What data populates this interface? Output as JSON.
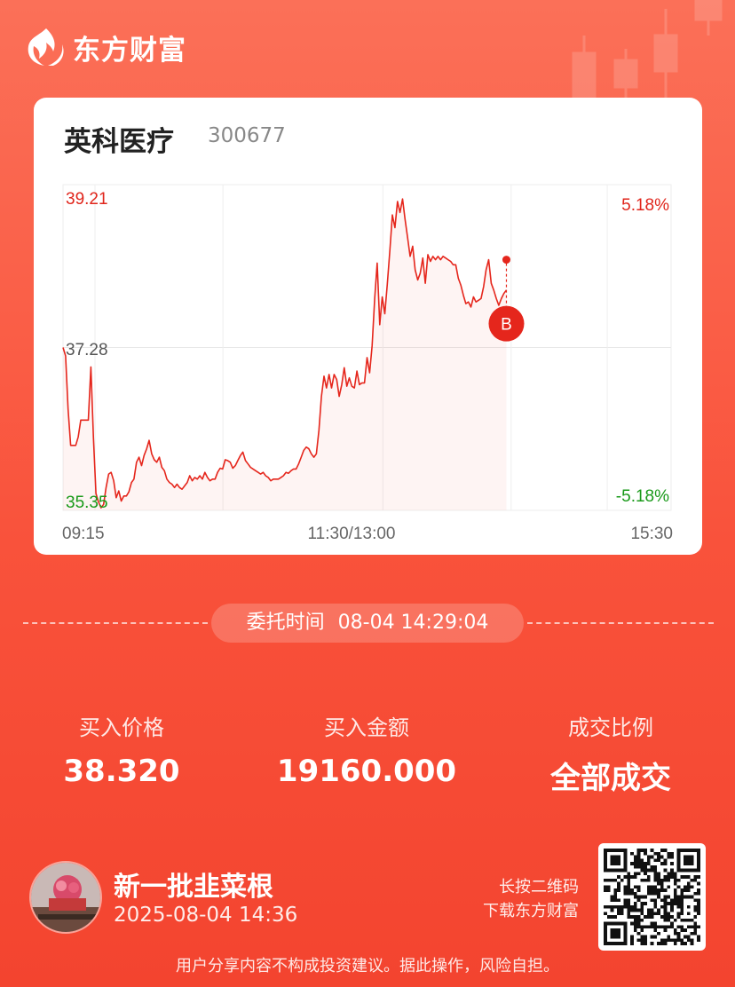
{
  "app": {
    "brand": "东方财富"
  },
  "stock": {
    "name": "英科医疗",
    "code": "300677"
  },
  "chart_data": {
    "type": "line",
    "title": "",
    "y_left_ticks": [
      "39.21",
      "37.28",
      "35.35"
    ],
    "y_right_ticks": [
      "5.18%",
      "-5.18%"
    ],
    "x_ticks": [
      "09:15",
      "11:30/13:00",
      "15:30"
    ],
    "ylim": [
      35.35,
      39.21
    ],
    "prev_close": 37.28,
    "series": [
      {
        "values": [
          37.28,
          37.18,
          36.55,
          36.12,
          36.12,
          36.12,
          36.22,
          36.42,
          36.42,
          36.42,
          36.42,
          37.05,
          36.2,
          35.55,
          35.45,
          35.38,
          35.42,
          35.62,
          35.78,
          35.8,
          35.7,
          35.5,
          35.58,
          35.46,
          35.52,
          35.52,
          35.57,
          35.68,
          35.72,
          35.92,
          35.98,
          35.88,
          36.0,
          36.08,
          36.18,
          36.02,
          35.95,
          35.92,
          35.98,
          35.86,
          35.82,
          35.72,
          35.68,
          35.66,
          35.62,
          35.66,
          35.62,
          35.6,
          35.64,
          35.68,
          35.76,
          35.7,
          35.74,
          35.72,
          35.76,
          35.72,
          35.8,
          35.74,
          35.7,
          35.72,
          35.72,
          35.8,
          35.85,
          35.84,
          35.95,
          35.94,
          35.92,
          35.85,
          35.88,
          35.94,
          36.0,
          36.04,
          35.94,
          35.9,
          35.86,
          35.84,
          35.82,
          35.8,
          35.78,
          35.8,
          35.76,
          35.74,
          35.7,
          35.72,
          35.72,
          35.72,
          35.74,
          35.76,
          35.8,
          35.79,
          35.82,
          35.84,
          35.84,
          35.9,
          35.98,
          36.06,
          36.1,
          36.08,
          36.02,
          35.98,
          36.02,
          36.3,
          36.7,
          36.94,
          36.8,
          36.96,
          36.8,
          36.96,
          36.9,
          36.7,
          36.84,
          37.04,
          36.82,
          36.92,
          36.82,
          36.8,
          37.0,
          36.84,
          36.86,
          36.86,
          37.16,
          36.98,
          37.3,
          37.86,
          38.28,
          37.55,
          37.88,
          37.68,
          38.03,
          38.43,
          38.85,
          38.7,
          39.01,
          38.88,
          39.04,
          38.8,
          38.58,
          38.36,
          38.48,
          38.2,
          38.08,
          38.16,
          38.34,
          38.04,
          38.38,
          38.3,
          38.36,
          38.32,
          38.36,
          38.32,
          38.36,
          38.34,
          38.32,
          38.3,
          38.26,
          38.26,
          38.1,
          38.02,
          37.9,
          37.8,
          37.82,
          37.76,
          37.88,
          37.82,
          37.84,
          37.86,
          38.0,
          38.2,
          38.32,
          38.04,
          37.96,
          37.86,
          37.78,
          37.86,
          37.92,
          37.96
        ]
      }
    ],
    "marker": {
      "label": "B",
      "time": "08-04 14:29",
      "price": 38.32
    }
  },
  "order": {
    "time_label": "委托时间",
    "time_value": "08-04 14:29:04"
  },
  "stats": [
    {
      "label": "买入价格",
      "value": "38.320"
    },
    {
      "label": "买入金额",
      "value": "19160.000"
    },
    {
      "label": "成交比例",
      "value": "全部成交"
    }
  ],
  "user": {
    "name": "新一批韭菜根",
    "datetime": "2025-08-04 14:36"
  },
  "qr": {
    "hint_line1": "长按二维码",
    "hint_line2": "下载东方财富"
  },
  "footer": {
    "disclaimer": "用户分享内容不构成投资建议。据此操作，风险自担。"
  },
  "colors": {
    "up": "#e0251b",
    "down": "#1a9a1a",
    "neutral": "#555555",
    "accent": "#f9523b"
  }
}
